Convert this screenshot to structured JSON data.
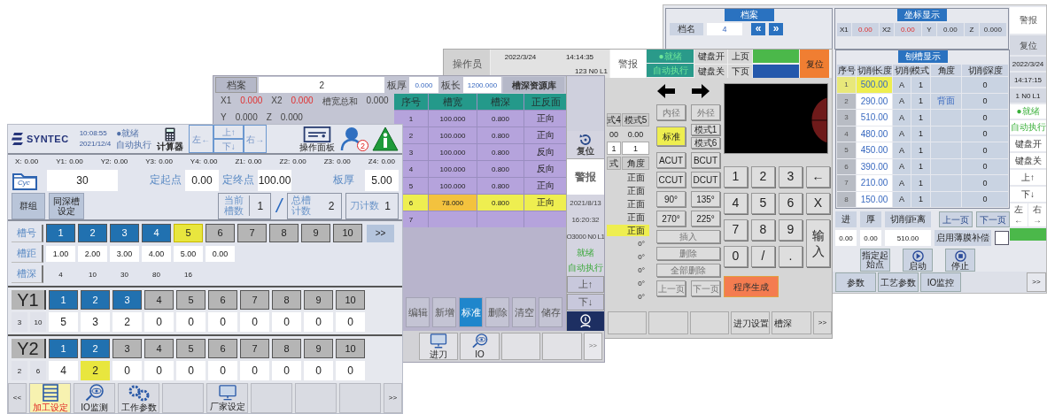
{
  "screen_a": {
    "header": {
      "brand": "SYNTEC",
      "time": "10:08:55",
      "date": "2021/12/4",
      "status": "●就绪",
      "mode": "自动执行",
      "calculator": "计算器",
      "jog": [
        "左←",
        "上↑",
        "下↓",
        "右→"
      ],
      "panel": "操作面板",
      "user_badge": "2"
    },
    "axes": [
      {
        "label": "X:",
        "value": "0.00"
      },
      {
        "label": "Y1:",
        "value": "0.00"
      },
      {
        "label": "Y2:",
        "value": "0.00"
      },
      {
        "label": "Y3:",
        "value": "0.00"
      },
      {
        "label": "Y4:",
        "value": "0.00"
      },
      {
        "label": "Z1:",
        "value": "0.00"
      },
      {
        "label": "Z2:",
        "value": "0.00"
      },
      {
        "label": "Z3:",
        "value": "0.00"
      },
      {
        "label": "Z4:",
        "value": "0.00"
      }
    ],
    "file": {
      "icon_text": "Cyc",
      "value": "30"
    },
    "fields": [
      {
        "label": "定起点",
        "value": "0.00"
      },
      {
        "label": "定终点",
        "value": "100.00"
      },
      {
        "label": "板厚",
        "value": "5.00"
      }
    ],
    "buttons": [
      "群组",
      "同深槽设定"
    ],
    "counters": [
      {
        "label": "当前槽数",
        "value": "1"
      },
      {
        "label": "总槽计数",
        "value": "2"
      },
      {
        "label": "刀计数",
        "value": "1"
      }
    ],
    "separator": "/",
    "slot_label": "槽号",
    "slots": [
      {
        "text": "1",
        "done": true,
        "current": false
      },
      {
        "text": "2",
        "done": true,
        "current": false
      },
      {
        "text": "3",
        "done": true,
        "current": false
      },
      {
        "text": "4",
        "done": true,
        "current": false
      },
      {
        "text": "5",
        "done": false,
        "current": true
      },
      {
        "text": "6",
        "done": false,
        "current": false
      },
      {
        "text": "7",
        "done": false,
        "current": false
      },
      {
        "text": "8",
        "done": false,
        "current": false
      },
      {
        "text": "9",
        "done": false,
        "current": false
      },
      {
        "text": "10",
        "done": false,
        "current": false
      }
    ],
    "slots_more": ">>",
    "pitch_label": "槽距",
    "pitch": [
      "1.00",
      "2.00",
      "3.00",
      "4.00",
      "5.00",
      "0.00"
    ],
    "depth_label": "槽深",
    "depth": [
      "4",
      "10",
      "30",
      "80",
      "16"
    ],
    "axis_groups": [
      {
        "name": "Y1",
        "counts": [
          "3",
          "10"
        ],
        "slots": [
          {
            "text": "1",
            "done": true,
            "current": false
          },
          {
            "text": "2",
            "done": true,
            "current": false
          },
          {
            "text": "3",
            "done": true,
            "current": false
          },
          {
            "text": "4",
            "done": false,
            "current": false
          },
          {
            "text": "5",
            "done": false,
            "current": false
          },
          {
            "text": "6",
            "done": false,
            "current": false
          },
          {
            "text": "7",
            "done": false,
            "current": false
          },
          {
            "text": "8",
            "done": false,
            "current": false
          },
          {
            "text": "9",
            "done": false,
            "current": false
          },
          {
            "text": "10",
            "done": false,
            "current": false
          }
        ],
        "values": [
          {
            "text": "5",
            "selected": false
          },
          {
            "text": "3",
            "selected": false
          },
          {
            "text": "2",
            "selected": false
          },
          {
            "text": "0",
            "selected": false
          },
          {
            "text": "0",
            "selected": false
          },
          {
            "text": "0",
            "selected": false
          },
          {
            "text": "0",
            "selected": false
          },
          {
            "text": "0",
            "selected": false
          },
          {
            "text": "0",
            "selected": false
          },
          {
            "text": "0",
            "selected": false
          }
        ]
      },
      {
        "name": "Y2",
        "counts": [
          "2",
          "6"
        ],
        "slots": [
          {
            "text": "1",
            "done": true,
            "current": false
          },
          {
            "text": "2",
            "done": true,
            "current": false
          },
          {
            "text": "3",
            "done": false,
            "current": false
          },
          {
            "text": "4",
            "done": false,
            "current": false
          },
          {
            "text": "5",
            "done": false,
            "current": false
          },
          {
            "text": "6",
            "done": false,
            "current": false
          },
          {
            "text": "7",
            "done": false,
            "current": false
          },
          {
            "text": "8",
            "done": false,
            "current": false
          },
          {
            "text": "9",
            "done": false,
            "current": false
          },
          {
            "text": "10",
            "done": false,
            "current": false
          }
        ],
        "values": [
          {
            "text": "4",
            "selected": false
          },
          {
            "text": "2",
            "selected": true
          },
          {
            "text": "0",
            "selected": false
          },
          {
            "text": "0",
            "selected": false
          },
          {
            "text": "0",
            "selected": false
          },
          {
            "text": "0",
            "selected": false
          },
          {
            "text": "0",
            "selected": false
          },
          {
            "text": "0",
            "selected": false
          },
          {
            "text": "0",
            "selected": false
          },
          {
            "text": "0",
            "selected": false
          }
        ]
      }
    ],
    "nav": {
      "prev": "<<",
      "next": ">>",
      "items": [
        {
          "kind": "list",
          "label": "加工设定",
          "selected": true
        },
        {
          "kind": "eye",
          "label": "IO监测",
          "selected": false
        },
        {
          "kind": "gears",
          "label": "工作参数",
          "selected": false
        },
        {
          "kind": "blank",
          "selected": false
        },
        {
          "kind": "monitor",
          "label": "厂家设定",
          "selected": false
        },
        {
          "kind": "blank",
          "selected": false
        },
        {
          "kind": "blank",
          "selected": false
        },
        {
          "kind": "blank",
          "selected": false
        }
      ]
    }
  },
  "screen_b": {
    "file_label": "档案",
    "file_value": "2",
    "thickness_label": "板厚",
    "thickness": "0.000",
    "length_label": "板长",
    "length": "1200.000",
    "library": "槽深资源库",
    "coords": [
      [
        {
          "label": "X1",
          "value": "0.000",
          "alert": true
        },
        {
          "label": "X2",
          "value": "0.000",
          "alert": true
        },
        {
          "label": "槽宽总和",
          "value": "0.000",
          "alert": false
        }
      ],
      [
        {
          "label": "Y",
          "value": "0.000",
          "alert": false
        },
        {
          "label": "Z",
          "value": "0.000",
          "alert": false
        }
      ]
    ],
    "columns": [
      "序号",
      "槽宽",
      "槽深",
      "正反面"
    ],
    "rows": [
      {
        "cells": [
          "1",
          "100.000",
          "0.800",
          "正向"
        ],
        "selected": false
      },
      {
        "cells": [
          "2",
          "100.000",
          "0.800",
          "正向"
        ],
        "selected": false
      },
      {
        "cells": [
          "3",
          "100.000",
          "0.800",
          "反向"
        ],
        "selected": false
      },
      {
        "cells": [
          "4",
          "100.000",
          "0.800",
          "反向"
        ],
        "selected": false
      },
      {
        "cells": [
          "5",
          "100.000",
          "0.800",
          "正向"
        ],
        "selected": false
      },
      {
        "cells": [
          "6",
          "78.000",
          "0.800",
          "正向"
        ],
        "selected": true
      },
      {
        "cells": [
          "7"
        ],
        "selected": false
      }
    ],
    "tools": [
      {
        "label": "编辑",
        "selected": false
      },
      {
        "label": "新增",
        "selected": false
      },
      {
        "label": "标准",
        "selected": true
      },
      {
        "label": "删除",
        "selected": false
      },
      {
        "label": "清空",
        "selected": false
      },
      {
        "label": "储存",
        "selected": false
      }
    ],
    "side": {
      "reset": "复位",
      "alarm": "警报",
      "date": "2021/8/13",
      "time": "16:20:32",
      "program": "O3000 N0 L1",
      "status": "就绪",
      "mode": "自动执行",
      "up": "上↑",
      "down": "下↓"
    },
    "nav": {
      "next": ">>",
      "items": [
        {
          "kind": "monitor",
          "label": "进刀",
          "selected": false
        },
        {
          "kind": "eye",
          "label": "IO",
          "selected": false
        },
        {
          "kind": "blank",
          "selected": false
        },
        {
          "kind": "blank",
          "selected": false
        }
      ]
    }
  },
  "screen_c": {
    "operator": "操作员",
    "date": "2022/3/24",
    "time": "14:14:35",
    "program": "123 N0 L1",
    "alarm": "警报",
    "status": "●就绪",
    "mode": "自动执行",
    "keyboard_on": "键盘开",
    "keyboard_off": "键盘关",
    "page_up": "上页",
    "page_down": "下页",
    "reset": "复位",
    "partial": {
      "tabs": [
        "式4",
        "模式5"
      ],
      "values": [
        "00",
        "0.00"
      ],
      "counts": [
        "1",
        "1"
      ],
      "columns": [
        "式",
        "角度"
      ],
      "faces": [
        {
          "text": "正面",
          "selected": false
        },
        {
          "text": "正面",
          "selected": false
        },
        {
          "text": "正面",
          "selected": false
        },
        {
          "text": "正面",
          "selected": false
        },
        {
          "text": "正面",
          "selected": true
        }
      ],
      "angles": [
        "0°",
        "0°",
        "0°",
        "0°",
        "0°"
      ]
    },
    "radius": [
      "内径",
      "外径"
    ],
    "modes": [
      {
        "label": "标准",
        "selected": true
      },
      {
        "label": "模式1",
        "selected": false
      },
      {
        "label": "模式6",
        "selected": false
      }
    ],
    "cuts": [
      "ACUT",
      "BCUT",
      "CCUT",
      "DCUT",
      "90°",
      "135°",
      "270°",
      "225°"
    ],
    "edits": [
      "插入",
      "删除",
      "全部删除"
    ],
    "pager": [
      "上一页",
      "下一页"
    ],
    "keypad": [
      "1",
      "2",
      "3",
      "←",
      "4",
      "5",
      "6",
      "X",
      "7",
      "8",
      "9",
      "0",
      "/",
      "."
    ],
    "enter_key": "输入",
    "generate": "程序生成",
    "nav": {
      "next": ">>",
      "items": [
        {
          "selected": false
        },
        {
          "selected": false
        },
        {
          "selected": false
        },
        {
          "label": "进刀设置",
          "selected": false
        },
        {
          "label": "槽深",
          "selected": false
        }
      ]
    }
  },
  "screen_d": {
    "file_title": "档案",
    "file_name_label": "档名",
    "file_name": "4",
    "prev": "«",
    "next": "»",
    "coords_title": "坐标显示",
    "coords": [
      {
        "label": "X1",
        "value": "0.00",
        "alert": true
      },
      {
        "label": "X2",
        "value": "0.00",
        "alert": true
      },
      {
        "label": "Y",
        "value": "0.00",
        "alert": false
      },
      {
        "label": "Z",
        "value": "0.000",
        "alert": false
      }
    ],
    "table_title": "刨槽显示",
    "columns": [
      "序号",
      "切削长度",
      "切削模式",
      "角度",
      "切削深度"
    ],
    "rows": [
      {
        "index": "1",
        "length": "500.00",
        "mode": "A",
        "count": "1",
        "depth": "0",
        "selected": true
      },
      {
        "index": "2",
        "length": "290.00",
        "mode": "A",
        "count": "1",
        "angle": "背面",
        "depth": "0",
        "selected": false
      },
      {
        "index": "3",
        "length": "510.00",
        "mode": "A",
        "count": "1",
        "depth": "0",
        "selected": false
      },
      {
        "index": "4",
        "length": "480.00",
        "mode": "A",
        "count": "1",
        "depth": "0",
        "selected": false
      },
      {
        "index": "5",
        "length": "450.00",
        "mode": "A",
        "count": "1",
        "depth": "0",
        "selected": false
      },
      {
        "index": "6",
        "length": "390.00",
        "mode": "A",
        "count": "1",
        "depth": "0",
        "selected": false
      },
      {
        "index": "7",
        "length": "210.00",
        "mode": "A",
        "count": "1",
        "depth": "0",
        "selected": false
      },
      {
        "index": "8",
        "length": "150.00",
        "mode": "A",
        "count": "1",
        "depth": "0",
        "selected": false
      }
    ],
    "param_labels": [
      "进",
      "厚",
      "切削距离"
    ],
    "param_values": [
      "0.00",
      "0.00",
      "510.00"
    ],
    "pager": [
      "上一页",
      "下一页"
    ],
    "compensation": {
      "label": "启用薄膜补偿",
      "checked": false
    },
    "actions": [
      {
        "kind": "text",
        "label": "指定起始点"
      },
      {
        "kind": "play",
        "label": "启动"
      },
      {
        "kind": "stop",
        "label": "停止"
      }
    ],
    "nav": {
      "next": ">>",
      "items": [
        {
          "label": "参数",
          "selected": false
        },
        {
          "label": "工艺参数",
          "selected": false
        },
        {
          "label": "IO监控",
          "selected": false
        }
      ]
    },
    "side": {
      "alarm": "警报",
      "reset": "复位",
      "date": "2022/3/24",
      "time": "14:17:15",
      "program": "1 N0 L1",
      "status": "●就绪",
      "mode": "自动执行",
      "keyboard_on": "键盘开",
      "keyboard_off": "键盘关",
      "up": "上↑",
      "down": "下↓",
      "left": "左←",
      "right": "右→"
    }
  }
}
